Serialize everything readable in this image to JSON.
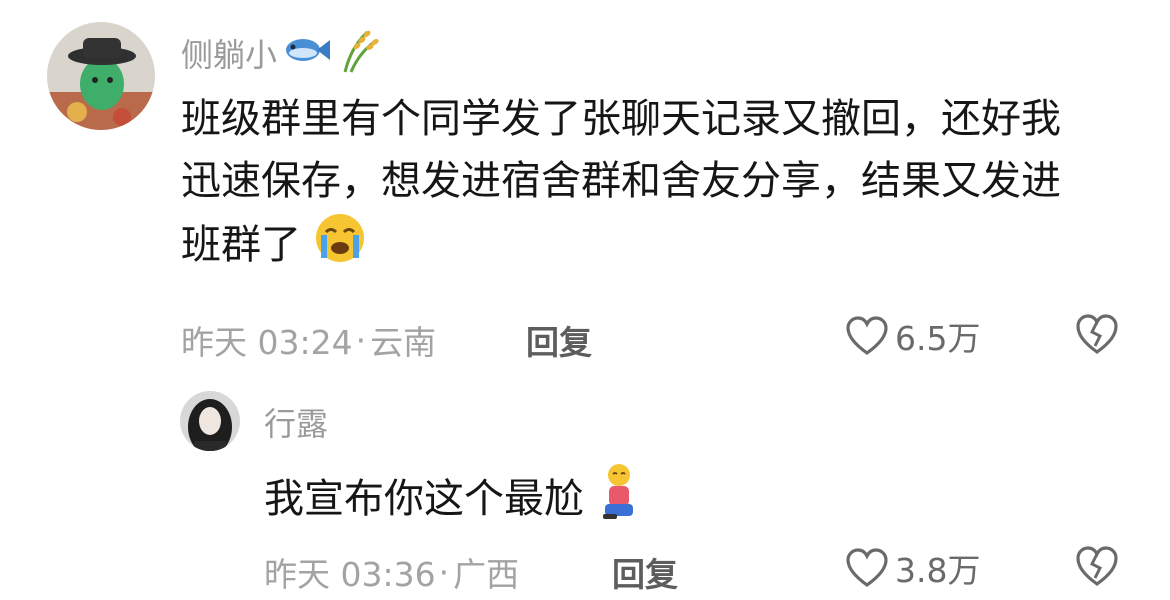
{
  "comments": [
    {
      "username": "侧躺小",
      "username_emojis": [
        "fish-icon",
        "rice-icon"
      ],
      "text": "班级群里有个同学发了张聊天记录又撤回，还好我迅速保存，想发进宿舍群和舍友分享，结果又发进班群了",
      "text_emoji": "crying-face-icon",
      "time": "昨天 03:24",
      "location": "云南",
      "reply_label": "回复",
      "likes": "6.5万"
    },
    {
      "username": "行露",
      "text": "我宣布你这个最尬",
      "text_emoji": "kneeling-person-icon",
      "time": "昨天 03:36",
      "location": "广西",
      "reply_label": "回复",
      "likes": "3.8万"
    }
  ],
  "colors": {
    "meta": "#a3a3a3",
    "text": "#161616",
    "icon": "#6a6a6a"
  }
}
